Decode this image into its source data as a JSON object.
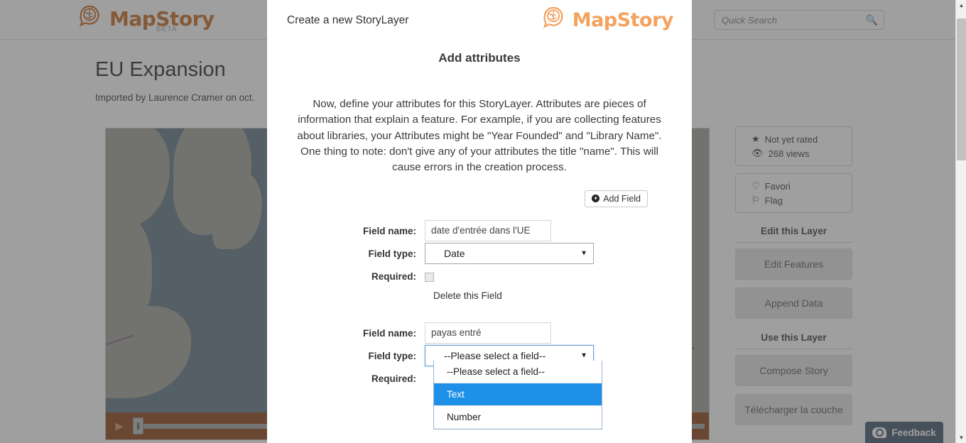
{
  "brand": {
    "name": "MapStory",
    "beta": "BETA",
    "globe_icon": "globe-speech-bubble-icon"
  },
  "search": {
    "placeholder": "Quick Search",
    "value": "",
    "icon": "search-icon"
  },
  "page": {
    "title": "EU Expansion",
    "subtitle": "Imported by Laurence Cramer on oct."
  },
  "map": {
    "zoom_in_label": "+",
    "zoom_out_label": "−",
    "play_label": "▶",
    "handle_label": "‖"
  },
  "rail": {
    "stats": [
      {
        "icon": "star-icon",
        "label": "Not yet rated"
      },
      {
        "icon": "eye-icon",
        "label": "268 views"
      }
    ],
    "actions": [
      {
        "icon": "heart-icon",
        "label": "Favori"
      },
      {
        "icon": "flag-icon",
        "label": "Flag"
      }
    ],
    "edit_heading": "Edit this Layer",
    "edit_buttons": [
      "Edit Features",
      "Append Data"
    ],
    "use_heading": "Use this Layer",
    "use_buttons": [
      "Compose Story",
      "Télécharger la couche"
    ]
  },
  "feedback": {
    "label": "Feedback",
    "icon": "camera-speech-icon"
  },
  "modal": {
    "title": "Create a new StoryLayer",
    "heading": "Add attributes",
    "body": "Now, define your attributes for this StoryLayer. Attributes are pieces of information that explain a feature. For example, if you are collecting features about libraries, your Attributes might be \"Year Founded\" and \"Library Name\". One thing to note: don't give any of your attributes the title \"name\". This will cause errors in the creation process.",
    "add_field_label": "Add Field",
    "add_field_icon": "plus-circle-icon",
    "labels": {
      "field_name": "Field name:",
      "field_type": "Field type:",
      "required": "Required:",
      "delete_field": "Delete this Field"
    },
    "fields": [
      {
        "name_value": "date d'entrée dans l'UE",
        "type_value": "Date",
        "required_checked": false,
        "dropdown_open": false
      },
      {
        "name_value": "payas entré",
        "type_value": "--Please select a field--",
        "required_checked": false,
        "dropdown_open": true
      }
    ],
    "type_options": [
      {
        "label": "--Please select a field--",
        "selected": false
      },
      {
        "label": "Text",
        "selected": true
      },
      {
        "label": "Number",
        "selected": false
      }
    ],
    "caret_icon": "chevron-down-icon"
  },
  "colors": {
    "brand_orange": "#c8651a",
    "modal_logo_orange": "#f3a35e",
    "dropdown_highlight": "#1e90e8",
    "timeline_bar": "#8a3d10",
    "feedback_bg": "#3a5069",
    "map_water": "#5a7282",
    "map_land": "#9b9b93"
  },
  "scrollbar": {
    "up": "▲",
    "down": "▼"
  }
}
